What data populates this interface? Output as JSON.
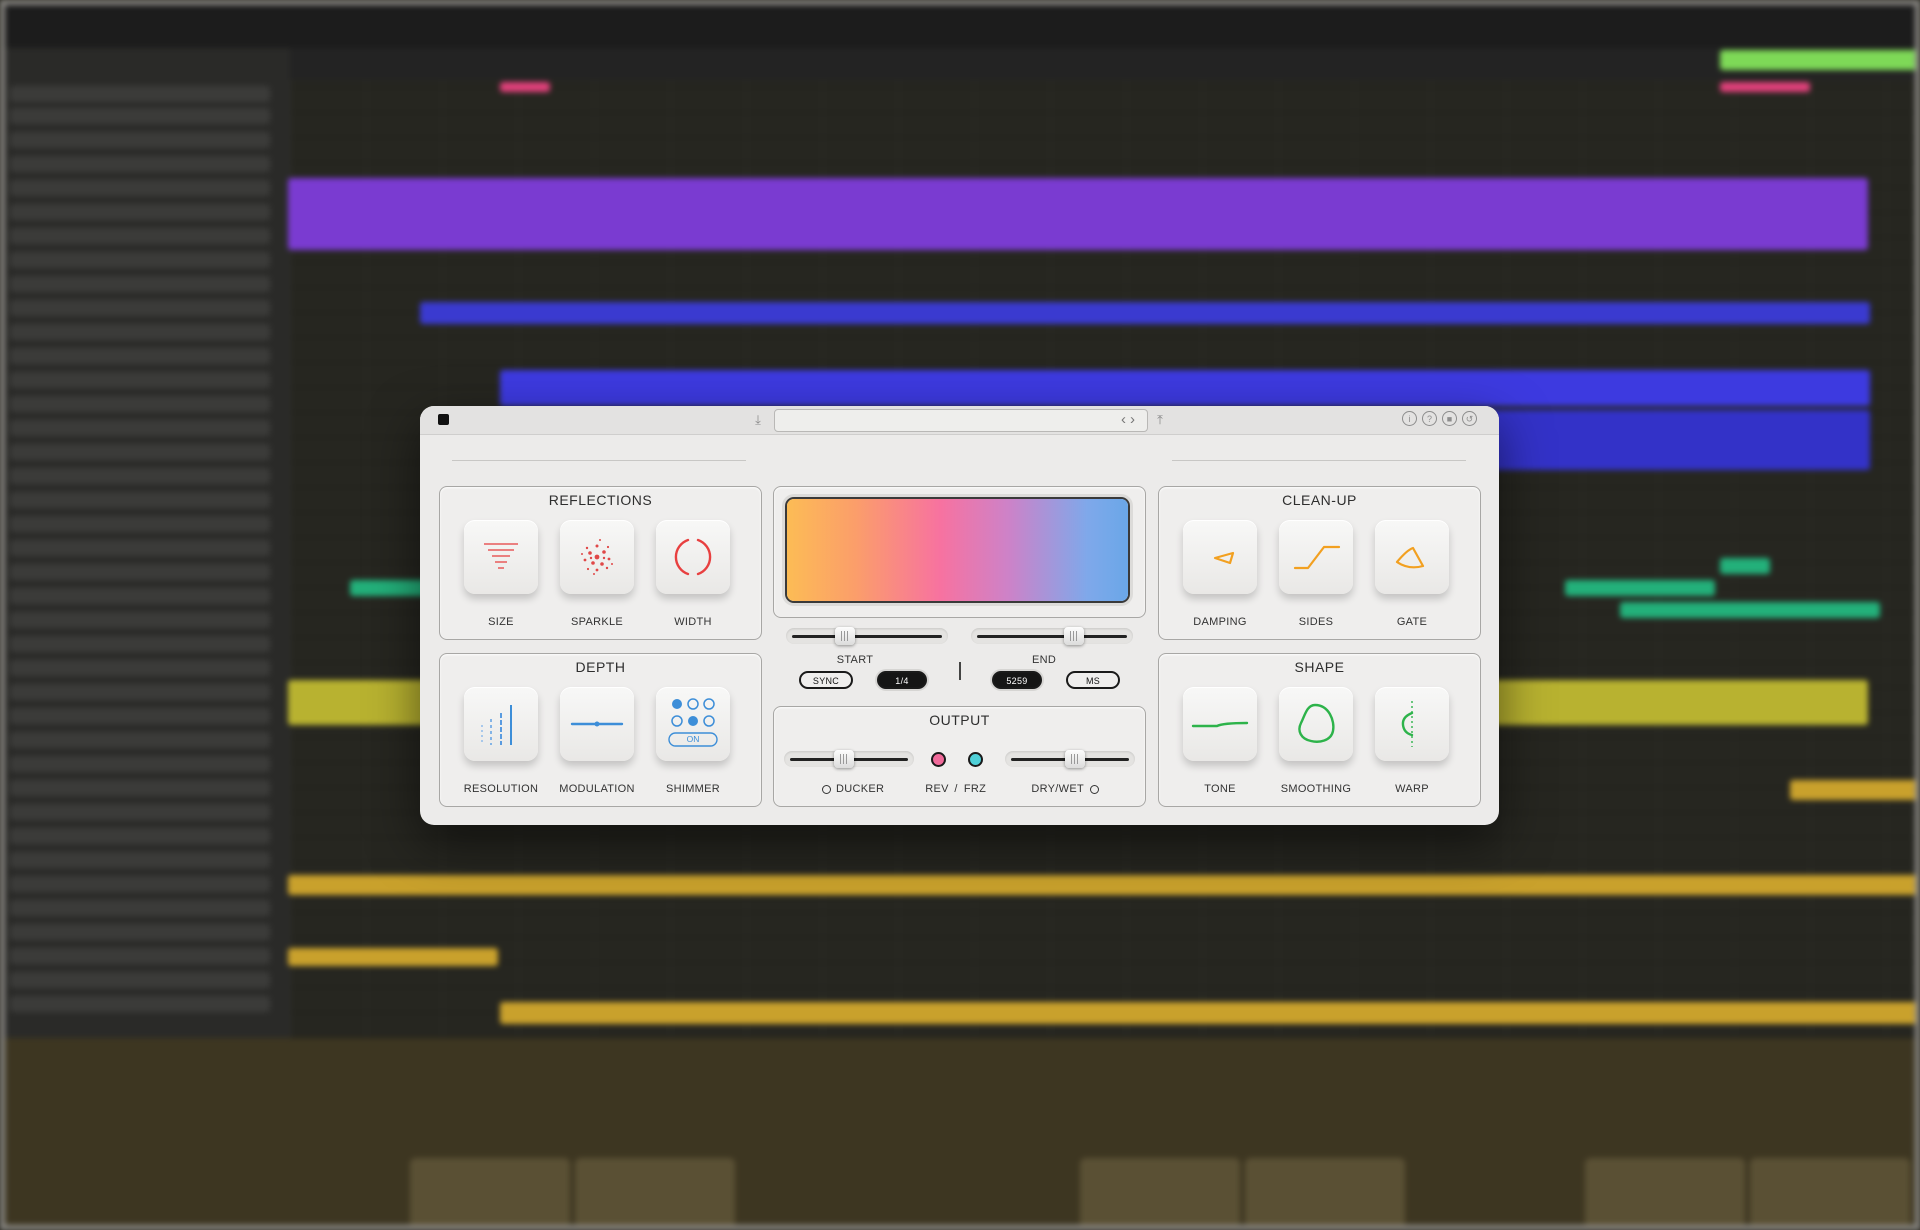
{
  "plugin": {
    "sections": {
      "reflections": {
        "title": "REFLECTIONS",
        "keys": [
          {
            "label": "SIZE",
            "icon": "size-icon",
            "color": "#e85a5a"
          },
          {
            "label": "SPARKLE",
            "icon": "sparkle-icon",
            "color": "#e04848"
          },
          {
            "label": "WIDTH",
            "icon": "width-icon",
            "color": "#e84040"
          }
        ]
      },
      "depth": {
        "title": "DEPTH",
        "keys": [
          {
            "label": "RESOLUTION",
            "icon": "resolution-icon",
            "color": "#5aa0e0"
          },
          {
            "label": "MODULATION",
            "icon": "modulation-icon",
            "color": "#3d8ed8"
          },
          {
            "label": "SHIMMER",
            "icon": "shimmer-icon",
            "color": "#3d8ed8",
            "toggle": "ON"
          }
        ]
      },
      "cleanup": {
        "title": "CLEAN-UP",
        "keys": [
          {
            "label": "DAMPING",
            "icon": "damping-icon",
            "color": "#f2a020"
          },
          {
            "label": "SIDES",
            "icon": "sides-icon",
            "color": "#f2a020"
          },
          {
            "label": "GATE",
            "icon": "gate-icon",
            "color": "#f2a020"
          }
        ]
      },
      "shape": {
        "title": "SHAPE",
        "keys": [
          {
            "label": "TONE",
            "icon": "tone-icon",
            "color": "#2db34a"
          },
          {
            "label": "SMOOTHING",
            "icon": "smoothing-icon",
            "color": "#2db34a"
          },
          {
            "label": "WARP",
            "icon": "warp-icon",
            "color": "#2db34a"
          }
        ]
      }
    },
    "freeze": {
      "start_label": "START",
      "end_label": "END",
      "start_value": 0.33,
      "end_value": 0.67,
      "sync_label": "SYNC",
      "division_label": "1/4",
      "ms_value": "5259",
      "ms_label": "MS"
    },
    "output": {
      "title": "OUTPUT",
      "ducker_label": "DUCKER",
      "rev_label": "REV",
      "separator": "/",
      "frz_label": "FRZ",
      "drywet_label": "DRY/WET",
      "ducker_value": 0.45,
      "drywet_value": 0.55,
      "rev_color": "#f06a9a",
      "frz_color": "#4fd0d8"
    },
    "gradient_colors": [
      "#fcbc55",
      "#f772a0",
      "#7fa8ea"
    ]
  }
}
